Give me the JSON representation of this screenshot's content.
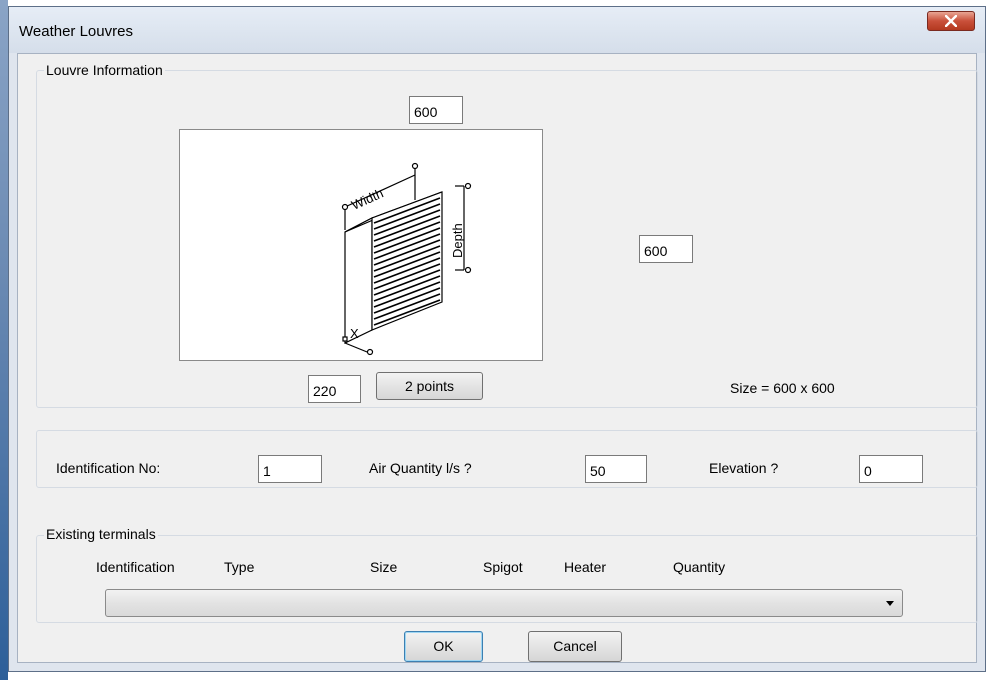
{
  "window": {
    "title": "Weather Louvres"
  },
  "louvre_info": {
    "group_label": "Louvre Information",
    "width_value": "600",
    "depth_value": "600",
    "x_value": "220",
    "two_points_label": "2 points",
    "size_text": "Size =  600 x 600",
    "diagram_labels": {
      "width": "Width",
      "depth": "Depth",
      "x": "X"
    }
  },
  "params": {
    "identification_label": "Identification No:",
    "identification_value": "1",
    "air_quantity_label": "Air Quantity l/s ?",
    "air_quantity_value": "50",
    "elevation_label": "Elevation ?",
    "elevation_value": "0"
  },
  "existing": {
    "group_label": "Existing terminals",
    "columns": [
      "Identification",
      "Type",
      "Size",
      "Spigot",
      "Heater",
      "Quantity"
    ],
    "selected": ""
  },
  "buttons": {
    "ok": "OK",
    "cancel": "Cancel"
  }
}
